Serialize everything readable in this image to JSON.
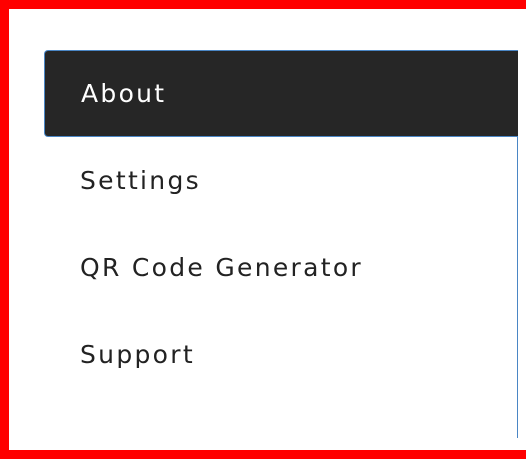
{
  "nav": {
    "items": [
      {
        "label": "About",
        "active": true
      },
      {
        "label": "Settings",
        "active": false
      },
      {
        "label": "QR Code Generator",
        "active": false
      },
      {
        "label": "Support",
        "active": false
      }
    ]
  },
  "colors": {
    "frame": "#ff0000",
    "active_background": "#262626",
    "active_text": "#ffffff",
    "text": "#222222",
    "accent_border": "#4a86c5"
  }
}
